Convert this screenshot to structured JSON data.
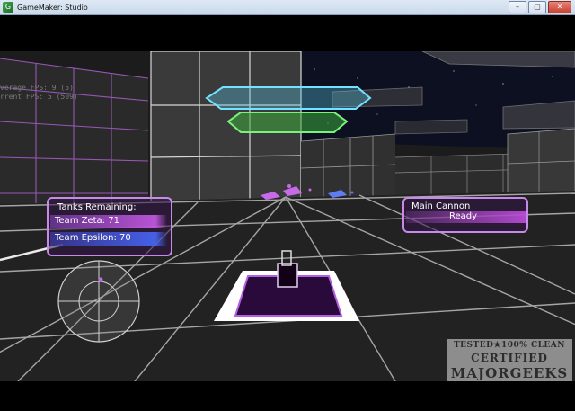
{
  "window": {
    "title": "GameMaker: Studio",
    "min": "–",
    "max": "▢",
    "close": "✕"
  },
  "debug": {
    "line1": "verage FPS: 9 (5)",
    "line2": "rrent FPS: 5 (509)"
  },
  "hud": {
    "tanks_title": "Tanks Remaining:",
    "teams": [
      {
        "label": "Team Zeta: 71",
        "color": "#c85ae6"
      },
      {
        "label": "Team Epsilon: 70",
        "color": "#4664f0"
      }
    ],
    "weapon_name": "Main Cannon",
    "weapon_status": "Ready",
    "accent": "#c78ae8"
  },
  "watermark": {
    "line1": "TESTED★100% CLEAN",
    "line2": "CERTIFIED",
    "line3": "MAJORGEEKS",
    "stars": "★★★★★★★"
  }
}
